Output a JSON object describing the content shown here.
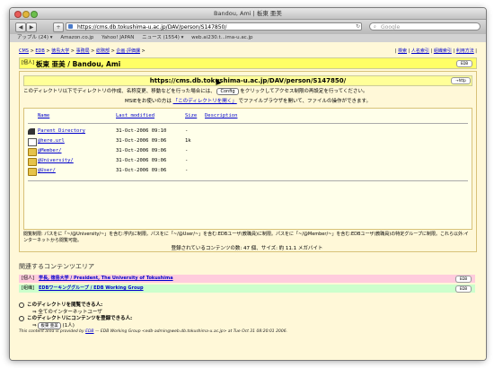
{
  "window": {
    "title": "Bandou, Ami | 板東 亜美"
  },
  "browser": {
    "back": "◀",
    "forward": "▶",
    "add": "+",
    "url": "https://cms.db.tokushima-u.ac.jp/DAV/person/S147850/",
    "reload": "↻",
    "search_placeholder": "Google",
    "bookmarks": [
      "アップル (24) ▾",
      "Amazon.co.jp",
      "Yahoo! JAPAN",
      "ニュース (1554) ▾",
      "web.ai230.t...ima-u.ac.jp"
    ]
  },
  "page": {
    "breadcrumbs": [
      "CMS",
      "EDB",
      "徳島大学",
      "事務局",
      "総務部",
      "企画·評価課"
    ],
    "right_links": [
      "検索",
      "人名索引",
      "組織索引",
      "利用方法"
    ],
    "person_tag": "[個人]",
    "person_name": "板東 亜美 / Bandou, Ami",
    "edb_button": "EDB",
    "dav_url": "https://cms.db.tokushima-u.ac.jp/DAV/person/S147850/",
    "http_button": "→http",
    "notice_pre": "このディレクトリ以下でディレクトリの作成、名称変更、移動などを行った場合には、",
    "config_button": "Config",
    "notice_post": "をクリックしてアクセス制限の再設定を行ってください。",
    "msie_pre": "MSIEをお使いの方は",
    "msie_link": "「このディレクトリを開く」",
    "msie_post": "でファイルブラウザを開いて、ファイルの操作ができます。",
    "listing": {
      "headers": {
        "name": "Name",
        "modified": "Last modified",
        "size": "Size",
        "description": "Description"
      },
      "rows": [
        {
          "icon": "back",
          "name": "Parent Directory",
          "date": "31-Oct-2006 09:10",
          "size": "-"
        },
        {
          "icon": "file",
          "name": "@here.url",
          "date": "31-Oct-2006 09:06",
          "size": "1k"
        },
        {
          "icon": "folder",
          "name": "@Member/",
          "date": "31-Oct-2006 09:06",
          "size": "-"
        },
        {
          "icon": "folder",
          "name": "@University/",
          "date": "31-Oct-2006 09:06",
          "size": "-"
        },
        {
          "icon": "folder",
          "name": "@User/",
          "date": "31-Oct-2006 09:06",
          "size": "-"
        }
      ]
    },
    "access_text": "閲覧制限: パスをに「~/@University/~」を含む:学内に制限。パスをに「~/@User/~」を含む:EDBユーザ(教職員)に制限。パスをに「~/@Member/~」を含む:EDBユーザ(教職員)の特定グループに制限。これら以外:インターネットから閲覧可能。",
    "count_text": "登録されているコンテンツの数: 47 個、サイズ: 約 11.1 メガバイト",
    "related_title": "関連するコンテンツエリア",
    "related": [
      {
        "tag": "[個人]",
        "link": "学長, 徳島大学 / President, The University of Tokushima",
        "button": "EDB",
        "color": "#ffccdd"
      },
      {
        "tag": "[組織]",
        "link": "EDBワーキンググループ / EDB Working Group",
        "button": "EDB",
        "color": "#ccffcc"
      }
    ],
    "permissions": [
      {
        "label": "このディレクトリを閲覧できる人:",
        "value": "⇒ 全てのインターネットユーザ"
      },
      {
        "label": "このディレクトリにコンテンツを登録できる人:",
        "value": "(1人)",
        "button": "板東 亜美"
      }
    ],
    "footer_pre": "This content area is provided by",
    "footer_link": "EDB",
    "footer_post": "— EDB Working Group <edb-admin@web.db.tokushima-u.ac.jp> at Tue Oct 31 08:20:01 2006."
  }
}
